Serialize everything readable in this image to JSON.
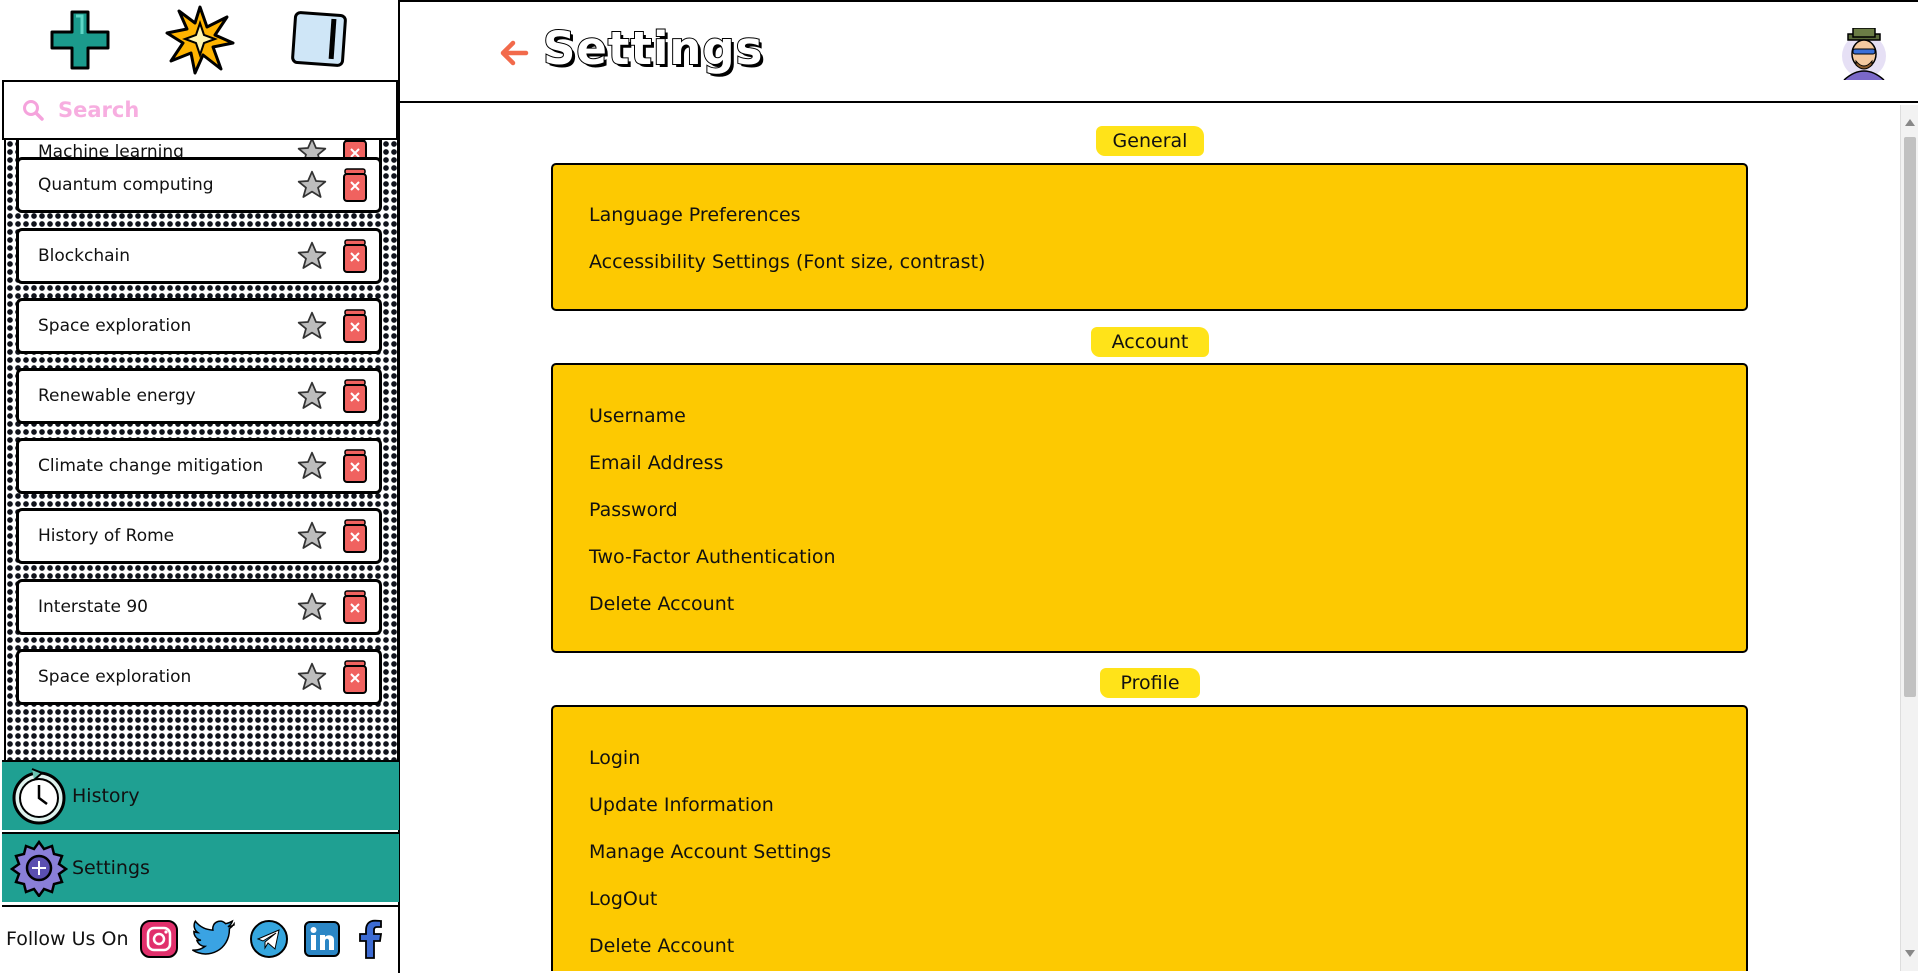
{
  "sidebar": {
    "search": {
      "placeholder": "Search"
    },
    "topbar": {
      "icons": [
        "plus-icon",
        "sparkle-icon",
        "sidebar-toggle-icon"
      ]
    },
    "chats": [
      {
        "label": "Machine learning"
      },
      {
        "label": "Quantum computing"
      },
      {
        "label": "Blockchain"
      },
      {
        "label": "Space exploration"
      },
      {
        "label": "Renewable energy"
      },
      {
        "label": "Climate change mitigation"
      },
      {
        "label": "History of Rome"
      },
      {
        "label": "Interstate 90"
      },
      {
        "label": "Space exploration"
      }
    ],
    "nav": {
      "history": "History",
      "settings": "Settings"
    },
    "follow": {
      "label": "Follow Us On",
      "socials": [
        "instagram-icon",
        "twitter-icon",
        "telegram-icon",
        "linkedin-icon",
        "facebook-icon"
      ]
    }
  },
  "header": {
    "title": "Settings"
  },
  "sections": {
    "general": {
      "title": "General",
      "items": [
        "Language Preferences",
        "Accessibility Settings (Font size, contrast)"
      ]
    },
    "account": {
      "title": "Account",
      "items": [
        "Username",
        "Email Address",
        "Password",
        "Two-Factor Authentication",
        "Delete Account"
      ]
    },
    "profile": {
      "title": "Profile",
      "items": [
        "Login",
        "Update Information",
        "Manage Account Settings",
        "LogOut",
        "Delete Account"
      ]
    }
  },
  "colors": {
    "accent_yellow": "#fdc901",
    "tag_yellow": "#ffe319",
    "teal": "#1fa092",
    "back_arrow": "#f26a4b",
    "search_pink": "#f7aee0",
    "trash_red": "#f0625f"
  }
}
